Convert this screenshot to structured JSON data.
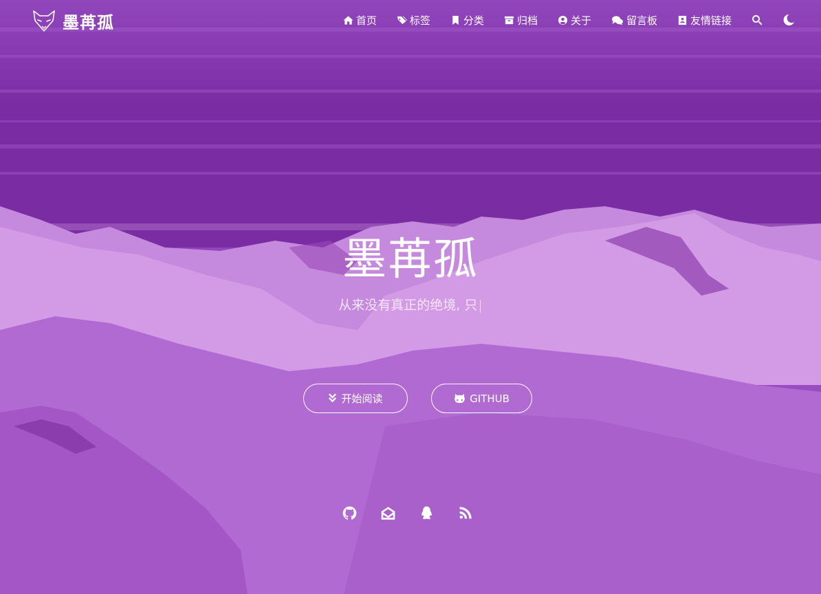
{
  "brand": {
    "name": "墨苒孤",
    "logo_icon": "fox-logo-icon"
  },
  "nav": {
    "items": [
      {
        "label": "首页",
        "icon": "home-icon"
      },
      {
        "label": "标签",
        "icon": "tags-icon"
      },
      {
        "label": "分类",
        "icon": "bookmark-icon"
      },
      {
        "label": "归档",
        "icon": "archive-icon"
      },
      {
        "label": "关于",
        "icon": "user-circle-icon"
      },
      {
        "label": "留言板",
        "icon": "comments-icon"
      },
      {
        "label": "友情链接",
        "icon": "address-book-icon"
      }
    ],
    "search_icon": "search-icon",
    "theme_icon": "moon-icon"
  },
  "hero": {
    "title": "墨苒孤",
    "subtitle": "从来没有真正的绝境, 只",
    "cursor": "|"
  },
  "buttons": {
    "read_label": "开始阅读",
    "github_label": "GITHUB"
  },
  "social": [
    {
      "icon": "github-icon"
    },
    {
      "icon": "envelope-open-icon"
    },
    {
      "icon": "qq-icon"
    },
    {
      "icon": "rss-icon"
    }
  ],
  "colors": {
    "overlay": "#9b4ec4",
    "text": "#ffffff"
  }
}
